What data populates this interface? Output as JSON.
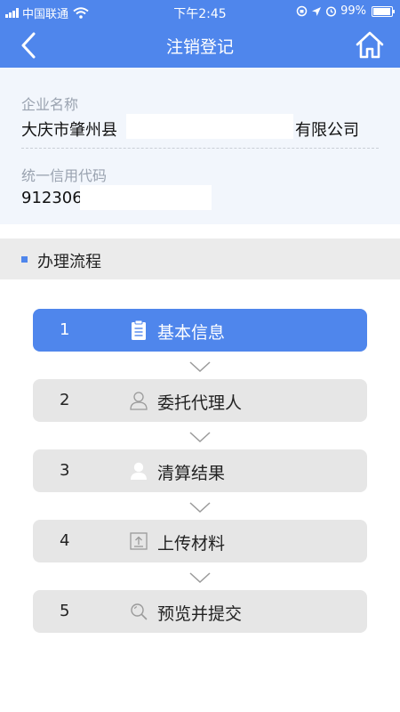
{
  "status_bar": {
    "carrier": "中国联通",
    "time": "下午2:45",
    "battery": "99%"
  },
  "nav": {
    "title": "注销登记",
    "back_icon": "chevron-left-icon",
    "home_icon": "home-icon"
  },
  "company": {
    "name_label": "企业名称",
    "name_prefix": "大庆市肇州县",
    "name_suffix": "有限公司",
    "code_label": "统一信用代码",
    "code_value": "9123060"
  },
  "section": {
    "title": "办理流程"
  },
  "steps": [
    {
      "num": "1",
      "label": "基本信息",
      "icon": "clipboard-icon",
      "active": true
    },
    {
      "num": "2",
      "label": "委托代理人",
      "icon": "person-outline-icon",
      "active": false
    },
    {
      "num": "3",
      "label": "清算结果",
      "icon": "person-filled-icon",
      "active": false
    },
    {
      "num": "4",
      "label": "上传材料",
      "icon": "upload-icon",
      "active": false
    },
    {
      "num": "5",
      "label": "预览并提交",
      "icon": "search-icon",
      "active": false
    }
  ],
  "colors": {
    "primary": "#4f86ec",
    "step_bg": "#e6e6e6",
    "info_bg": "#f2f6fc"
  }
}
